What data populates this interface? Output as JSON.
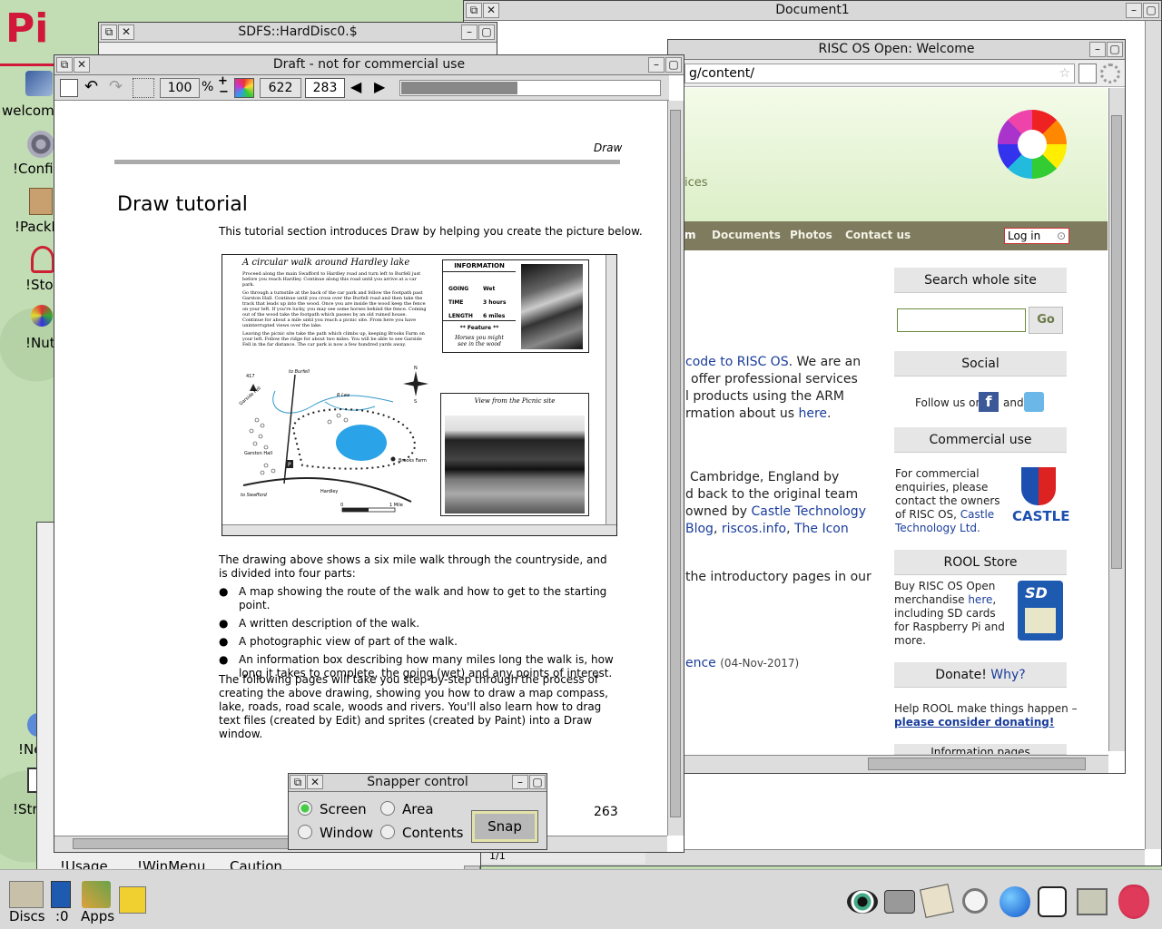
{
  "desktop": {
    "logo_text": "Pi",
    "icons": [
      {
        "label": "welcome"
      },
      {
        "label": "!Config"
      },
      {
        "label": "!PackM"
      },
      {
        "label": "!Stor"
      },
      {
        "label": "!NutP"
      },
      {
        "label": "!Ne"
      },
      {
        "label": "!Stro"
      }
    ],
    "bottom_icons": [
      {
        "label": "!Usage"
      },
      {
        "label": "!WinMenu"
      },
      {
        "label": "Caution"
      }
    ]
  },
  "doc1": {
    "title": "Document1",
    "status": "1/1"
  },
  "hdisc": {
    "title": "SDFS::HardDisc0.$"
  },
  "browser": {
    "title": "RISC OS Open: Welcome",
    "url": "g/content/",
    "subtitle_fragment": "ices",
    "nav": [
      "m",
      "Documents",
      "Photos",
      "Contact us"
    ],
    "login": "Log in",
    "search": {
      "title": "Search whole site",
      "go": "Go"
    },
    "social": {
      "title": "Social",
      "follow": "Follow us on",
      "and": "and"
    },
    "commercial": {
      "title": "Commercial use",
      "text": "For commercial enquiries, please contact the owners of RISC OS,",
      "link": "Castle Technology Ltd.",
      "logo": "CASTLE"
    },
    "store": {
      "title": "ROOL Store",
      "text1": "Buy RISC OS Open merchandise",
      "link": "here",
      "text2": ", including SD cards for Raspberry Pi and more.",
      "sd": "SD"
    },
    "donate": {
      "title": "Donate!",
      "why": "Why?",
      "text": "Help ROOL make things happen –",
      "link": "please consider donating!"
    },
    "info": "Information pages",
    "body1": {
      "link": "code to RISC OS",
      "t1": ". We are an",
      "t2": "offer professional services",
      "t3": "l products using the ARM",
      "t4": "rmation about us",
      "here": "here",
      "dot": "."
    },
    "body2": {
      "t1": "Cambridge, England by",
      "t2": "d back to the original team",
      "t3": "owned by",
      "l1": "Castle Technology",
      "l2": "Blog",
      "l3": "riscos.info",
      "l4": "The Icon"
    },
    "body3": "the introductory pages in our",
    "body4": {
      "link": "ence",
      "date": "(04-Nov-2017)"
    }
  },
  "draft": {
    "title": "Draft - not for commercial use",
    "zoom": "100",
    "zoom_unit": "%",
    "width": "622",
    "height": "283",
    "progress": 0.45,
    "header": "Draw",
    "heading": "Draw tutorial",
    "intro": "This tutorial section introduces Draw by helping you create the picture below.",
    "figure": {
      "title": "A circular walk around Hardley lake",
      "p1": "Proceed along the main Swafford to Hardley road and turn left to Burfell just before you reach Hardley. Continue along this road until you arrive at a car park.",
      "p2": "Go through a turnstile at the back of the car park and follow the footpath past Garston Hall. Continue until you cross over the Burfell road and then take the track that leads up into the wood. Once you are inside the wood keep the fence on your left. If you're lucky, you may see some horses behind the fence. Coming out of the wood take the footpath which passes by an old ruined house. Continue for about a mile until you reach a picnic site. From here you have uninterrupted views over the lake.",
      "p3": "Leaving the picnic site take the path which climbs up, keeping Brooks Farm on your left. Follow the ridge for about two miles. You will be able to see Garside Fell in the far distance. The car park is now a few hundred yards away.",
      "info_title": "INFORMATION",
      "info_rows": [
        [
          "GOING",
          "Wet"
        ],
        [
          "TIME",
          "3 hours"
        ],
        [
          "LENGTH",
          "6 miles"
        ]
      ],
      "feature": "** Feature **",
      "feature_caption": "Horses you might see in the wood",
      "view_caption": "View from the Picnic site",
      "map_labels": {
        "burfell": "to Burfell",
        "garside": "Garside Fell",
        "h417": "417",
        "river": "R Lea",
        "hall": "Garston Hall",
        "brooks": "Brooks Farm",
        "hardley": "Hardley",
        "swafford": "to Swafford",
        "p": "P",
        "scale0": "0",
        "scale1": "1 Mile",
        "n": "N",
        "s": "S"
      }
    },
    "body": "The drawing above shows a six mile walk through the countryside, and is divided into four parts:",
    "bullets": [
      "A map showing the route of the walk and how to get to the starting point.",
      "A written description of the walk.",
      "A photographic view of part of the walk.",
      "An information box describing how many miles long the walk is, how long it takes to complete, the going (wet) and any points of interest."
    ],
    "closing": "The following pages will take you step-by-step through the process of creating the above drawing, showing you how to draw a map compass, lake, roads, road scale, woods and rivers. You'll also learn how to drag text files (created by Edit) and sprites (created by Paint) into a Draw window.",
    "page_number": "263"
  },
  "snapper": {
    "title": "Snapper control",
    "options": [
      {
        "label": "Screen",
        "selected": true
      },
      {
        "label": "Area",
        "selected": false
      },
      {
        "label": "Window",
        "selected": false
      },
      {
        "label": "Contents",
        "selected": false
      }
    ],
    "snap": "Snap"
  },
  "iconbar": {
    "discs": "Discs",
    "ram": ":0",
    "apps": "Apps",
    "right_icons": [
      "eye-icon",
      "camera-icon",
      "scroll-icon",
      "magnifier-icon",
      "globe-icon",
      "hand-icon",
      "monitor-icon",
      "raspberry-icon"
    ]
  }
}
